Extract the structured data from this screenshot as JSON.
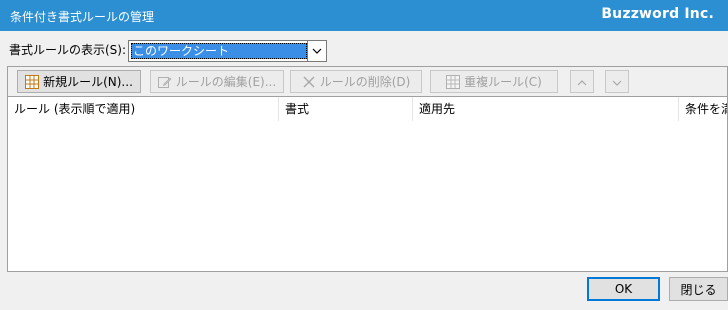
{
  "window": {
    "title": "条件付き書式ルールの管理",
    "watermark": "Buzzword Inc."
  },
  "scope": {
    "label": "書式ルールの表示(S):",
    "selected": "このワークシート"
  },
  "toolbar": {
    "new_rule": "新規ルール(N)...",
    "edit_rule": "ルールの編集(E)...",
    "delete_rule": "ルールの削除(D)",
    "duplicate_rule": "重複ルール(C)"
  },
  "columns": [
    "ルール (表示順で適用)",
    "書式",
    "適用先",
    "条件を満"
  ],
  "buttons": {
    "ok": "OK",
    "close": "閉じる"
  },
  "colors": {
    "titlebar": "#2b8fd1",
    "selection": "#3a8ee6",
    "window_bg": "#f0f0f0"
  }
}
